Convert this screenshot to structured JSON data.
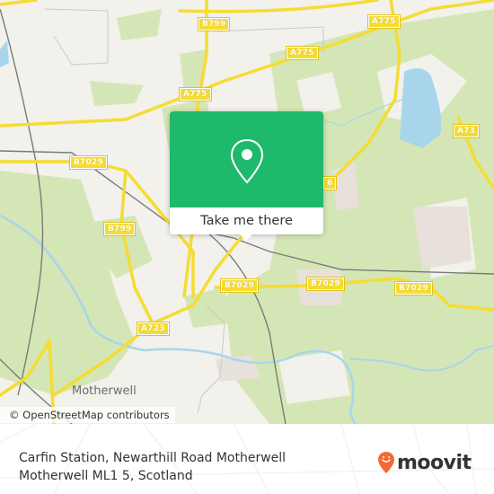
{
  "map": {
    "attribution": "© OpenStreetMap contributors",
    "place_labels": [
      {
        "name": "Motherwell"
      }
    ],
    "road_labels": [
      "B799",
      "A775",
      "A775",
      "A775",
      "A73",
      "B7029",
      "B799",
      "B7029",
      "B7029",
      "B7029",
      "A723",
      "6"
    ],
    "colors": {
      "land": "#f2f1ec",
      "green": "#d4e6b5",
      "water": "#a8d5ec",
      "road": "#f5dc33",
      "rail": "#7a7a7a"
    }
  },
  "popup": {
    "icon": "location-pin-icon",
    "button_label": "Take me there",
    "color": "#1fb96b"
  },
  "footer": {
    "address_line1": "Carfin Station, Newarthill Road Motherwell",
    "address_line2": "Motherwell ML1 5, Scotland",
    "brand": "moovit",
    "brand_color": "#f26a35"
  }
}
